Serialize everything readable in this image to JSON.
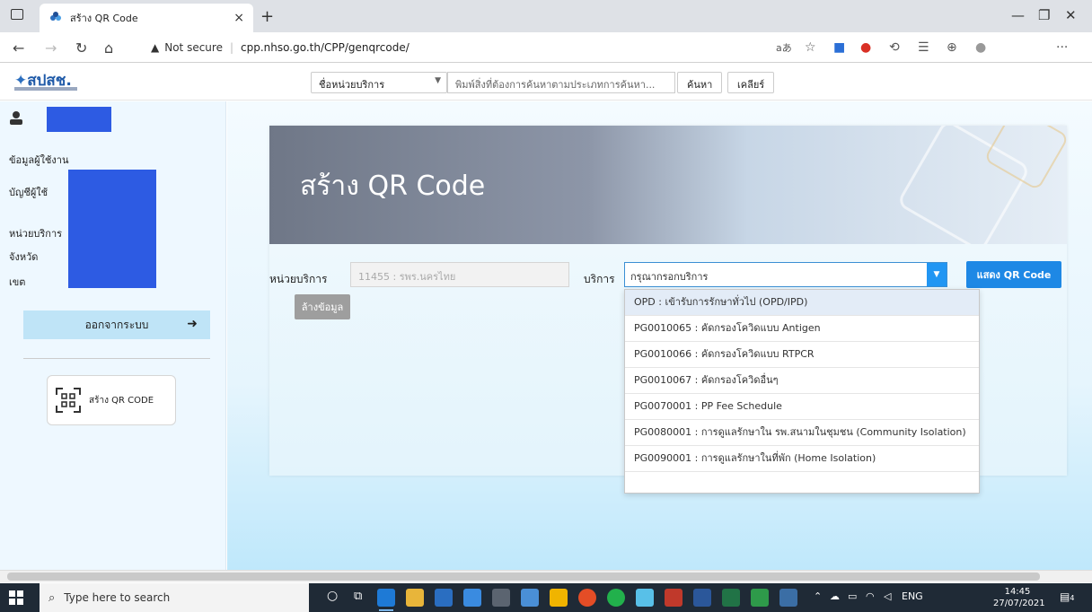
{
  "browser": {
    "tab_title": "สร้าง QR Code",
    "tab_close": "×",
    "new_tab": "+",
    "security_label": "Not secure",
    "url": "cpp.nhso.go.th/CPP/genqrcode/",
    "read_aloud": "aあ",
    "more": "···"
  },
  "site": {
    "logo_text": "สปสช.",
    "search_type_value": "ชื่อหน่วยบริการ",
    "search_placeholder": "พิมพ์สิ่งที่ต้องการค้นหาตามประเภทการค้นหา...",
    "search_button": "ค้นหา",
    "clear_button": "เคลียร์"
  },
  "sidebar": {
    "user_info": "ข้อมูลผู้ใช้งาน",
    "account": "บัญชีผู้ใช้",
    "service_unit": "หน่วยบริการ",
    "province": "จังหวัด",
    "zone": "เขต",
    "logout": "ออกจากระบบ",
    "qr_menu": "สร้าง QR CODE"
  },
  "main": {
    "page_title": "สร้าง QR Code",
    "unit_label": "หน่วยบริการ",
    "unit_value": "11455 : รพร.นครไทย",
    "service_label": "บริการ",
    "service_placeholder": "กรุณากรอกบริการ",
    "show_qr_button": "แสดง QR Code",
    "clear_data_button": "ล้างข้อมูล",
    "service_options": [
      "OPD : เข้ารับการรักษาทั่วไป (OPD/IPD)",
      "PG0010065 : คัดกรองโควิดแบบ Antigen",
      "PG0010066 : คัดกรองโควิดแบบ RTPCR",
      "PG0010067 : คัดกรองโควิดอื่นๆ",
      "PG0070001 : PP Fee Schedule",
      "PG0080001 : การดูแลรักษาใน รพ.สนามในชุมชน (Community Isolation)",
      "PG0090001 : การดูแลรักษาในที่พัก (Home Isolation)"
    ]
  },
  "taskbar": {
    "search_placeholder": "Type here to search",
    "language": "ENG",
    "time": "14:45",
    "date": "27/07/2021",
    "notifications": "4"
  },
  "colors": {
    "accent": "#1e88e5",
    "redact": "#2d5be3",
    "sidebar_bg": "#eef8ff"
  }
}
